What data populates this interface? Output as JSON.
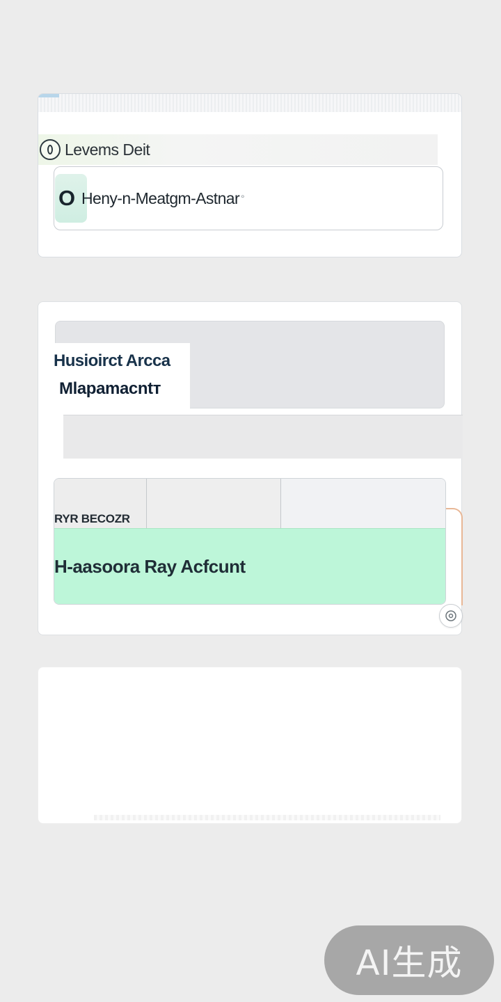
{
  "card_one": {
    "title": "Levems Deit",
    "search": {
      "leading_glyph": "O",
      "value": "Heny-n-Meatgm-Astnar",
      "trailing_glyph": "°"
    }
  },
  "category": {
    "line1": "Husioirct Arcca",
    "line2": "Mlapamacntт"
  },
  "table": {
    "header_label": "RYR BECOZR",
    "row_label": "H-aasoora Ray Acfcunt",
    "row_color": "#bdf6d9"
  },
  "watermark": {
    "text": "AI生成"
  },
  "colors": {
    "background": "#ececec",
    "card": "#ffffff",
    "accent_green": "#bdf6d9",
    "accent_orange": "#e8b796"
  }
}
